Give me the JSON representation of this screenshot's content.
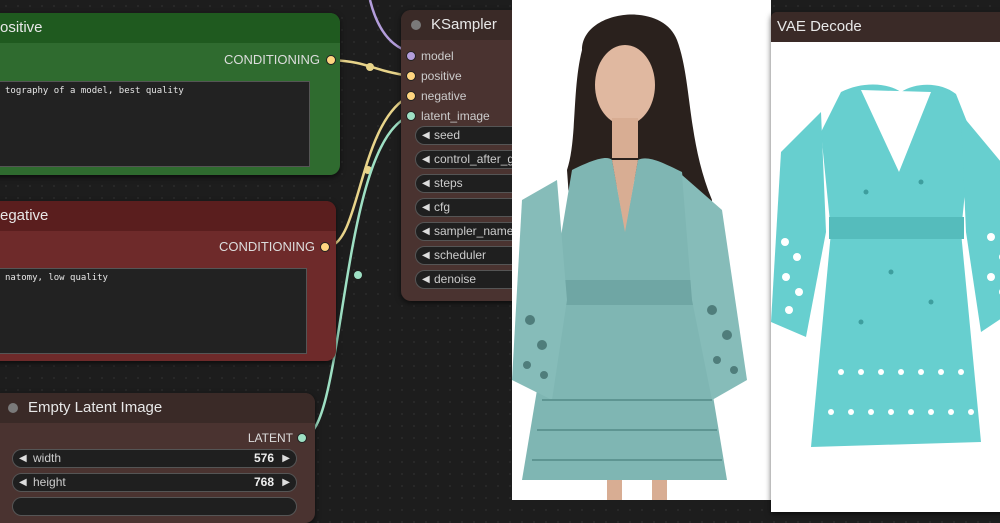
{
  "colors": {
    "positive": "#2f6b2f",
    "negative": "#6e2a2a",
    "latent": "#4a3330",
    "ksampler": "#4a3330",
    "model": "#b39ddb",
    "conditioning": "#ffd580",
    "latent_sock": "#9ee0c4"
  },
  "positive": {
    "title": "ositive",
    "output_label": "CONDITIONING",
    "text": "tography of a model, best quality"
  },
  "negative": {
    "title": "egative",
    "output_label": "CONDITIONING",
    "text": "natomy, low quality"
  },
  "latent": {
    "title": "Empty Latent Image",
    "output_label": "LATENT",
    "width_label": "width",
    "width_value": "576",
    "height_label": "height",
    "height_value": "768"
  },
  "ksampler": {
    "title": "KSampler",
    "inputs": [
      "model",
      "positive",
      "negative",
      "latent_image"
    ],
    "widgets": [
      "seed",
      "control_after_g",
      "steps",
      "cfg",
      "sampler_name",
      "scheduler",
      "denoise"
    ]
  },
  "vae": {
    "title": "VAE Decode"
  }
}
